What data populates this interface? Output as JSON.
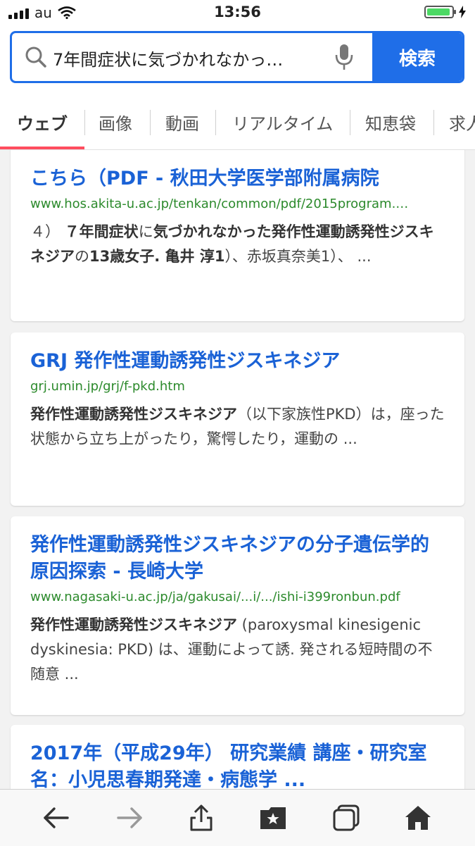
{
  "status_bar": {
    "carrier": "au",
    "time": "13:56",
    "battery_color": "#4cd964"
  },
  "search": {
    "query": "7年間症状に気づかれなかっ…",
    "button_label": "検索",
    "accent_color": "#1f6ee8"
  },
  "tabs": [
    {
      "label": "ウェブ"
    },
    {
      "label": "画像"
    },
    {
      "label": "動画"
    },
    {
      "label": "リアルタイム"
    },
    {
      "label": "知恵袋"
    },
    {
      "label": "求人"
    }
  ],
  "results": [
    {
      "title": "こちら（PDF - 秋田大学医学部附属病院",
      "url": "www.hos.akita-u.ac.jp/tenkan/common/pdf/2015program.…",
      "snippet_parts": [
        {
          "text": "４） ",
          "bold": false
        },
        {
          "text": "７年間症状",
          "bold": true
        },
        {
          "text": "に",
          "bold": false
        },
        {
          "text": "気づかれなかった発作性運動誘発性ジスキネジア",
          "bold": true
        },
        {
          "text": "の",
          "bold": false
        },
        {
          "text": "13歳女子. 亀井 淳1",
          "bold": true
        },
        {
          "text": "）、赤坂真奈美1）、 ...",
          "bold": false
        }
      ]
    },
    {
      "title": "GRJ 発作性運動誘発性ジスキネジア",
      "url": "grj.umin.jp/grj/f-pkd.htm",
      "snippet_parts": [
        {
          "text": "発作性運動誘発性ジスキネジア",
          "bold": true
        },
        {
          "text": "（以下家族性PKD）は，座った状態から立ち上がったり，驚愕したり，運動の ...",
          "bold": false
        }
      ]
    },
    {
      "title": "発作性運動誘発性ジスキネジアの分子遺伝学的原因探索 - 長崎大学",
      "url": "www.nagasaki-u.ac.jp/ja/gakusai/...i/.../ishi-i399ronbun.pdf",
      "snippet_parts": [
        {
          "text": "発作性運動誘発性ジスキネジア",
          "bold": true
        },
        {
          "text": " (paroxysmal kinesigenic dyskinesia: PKD) は、運動によって誘. 発される短時間の不随意 ...",
          "bold": false
        }
      ]
    },
    {
      "title": "2017年（平成29年） 研究業績 講座・研究室名：小児思春期発達・病態学 ...",
      "url": "",
      "snippet_parts": []
    }
  ],
  "toolbar": {
    "icons": [
      "back-arrow-icon",
      "forward-arrow-icon",
      "share-icon",
      "bookmarks-icon",
      "tabs-icon",
      "home-icon"
    ]
  }
}
